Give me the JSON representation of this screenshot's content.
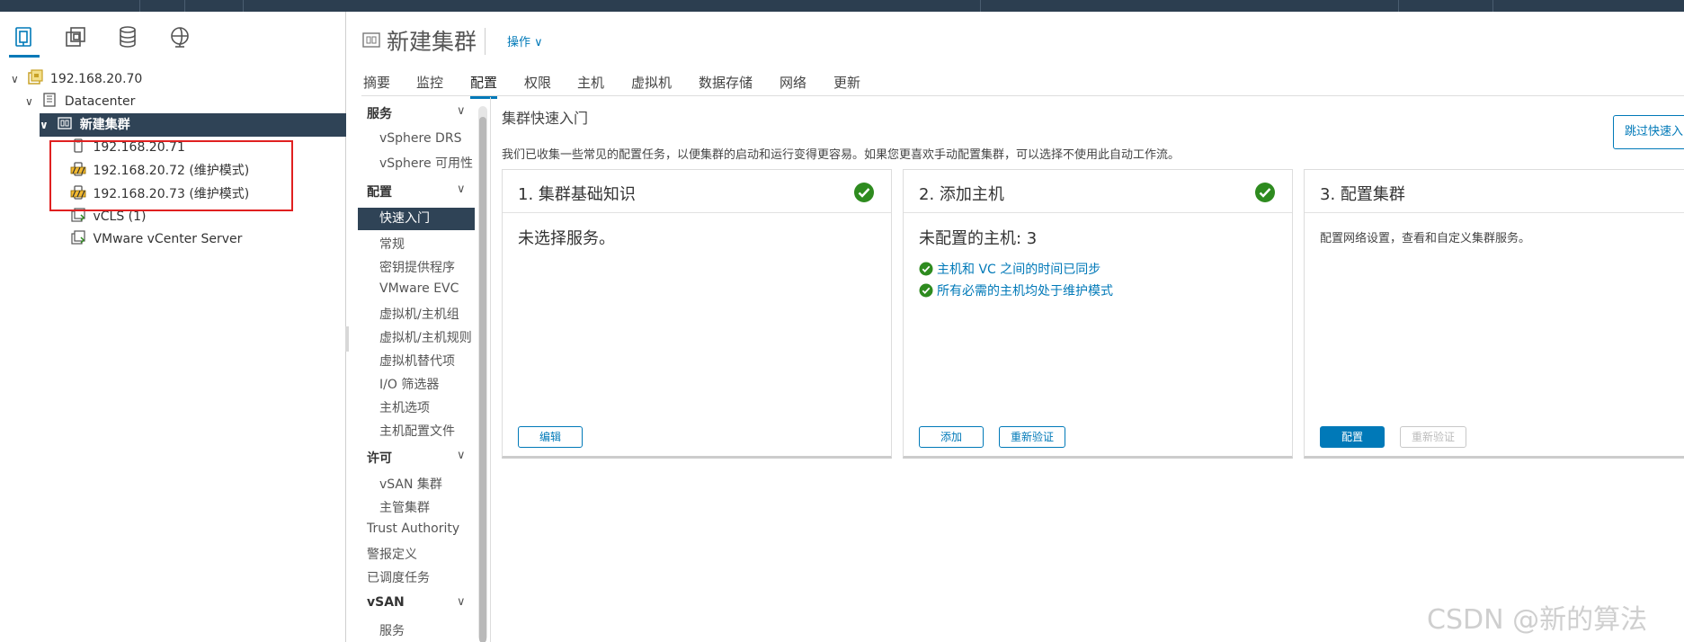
{
  "colors": {
    "accent": "#0079b8",
    "selected_bg": "#2f4356",
    "success": "#2e8b1f",
    "alert_red": "#e02020"
  },
  "nav_icons": [
    "hosts-clusters-icon",
    "vms-templates-icon",
    "storage-icon",
    "network-icon"
  ],
  "tree": {
    "vcenter": "192.168.20.70",
    "datacenter": "Datacenter",
    "cluster": "新建集群",
    "hosts": [
      "192.168.20.71",
      "192.168.20.72 (维护模式)",
      "192.168.20.73 (维护模式)"
    ],
    "vcls": "vCLS (1)",
    "vcenter_vm": "VMware vCenter Server"
  },
  "header": {
    "title": "新建集群",
    "actions": "操作"
  },
  "tabs": [
    "摘要",
    "监控",
    "配置",
    "权限",
    "主机",
    "虚拟机",
    "数据存储",
    "网络",
    "更新"
  ],
  "config_nav": {
    "services_header": "服务",
    "services": [
      "vSphere DRS",
      "vSphere 可用性"
    ],
    "config_header": "配置",
    "config": [
      "快速入门",
      "常规",
      "密钥提供程序",
      "VMware EVC",
      "虚拟机/主机组",
      "虚拟机/主机规则",
      "虚拟机替代项",
      "I/O 筛选器",
      "主机选项",
      "主机配置文件"
    ],
    "license_header": "许可",
    "license": [
      "vSAN 集群",
      "主管集群"
    ],
    "other": [
      "Trust Authority",
      "警报定义",
      "已调度任务"
    ],
    "vsan_header": "vSAN",
    "vsan": [
      "服务"
    ]
  },
  "quickstart": {
    "title": "集群快速入门",
    "skip_button": "跳过快速入门",
    "description": "我们已收集一些常见的配置任务，以便集群的启动和运行变得更容易。如果您更喜欢手动配置集群，可以选择不使用此自动工作流。",
    "card1": {
      "title": "1. 集群基础知识",
      "body": "未选择服务。",
      "edit": "编辑"
    },
    "card2": {
      "title": "2. 添加主机",
      "body": "未配置的主机: 3",
      "check1": "主机和 VC 之间的时间已同步",
      "check2": "所有必需的主机均处于维护模式",
      "add": "添加",
      "revalidate": "重新验证"
    },
    "card3": {
      "title": "3. 配置集群",
      "body": "配置网络设置，查看和自定义集群服务。",
      "configure": "配置",
      "revalidate": "重新验证"
    }
  },
  "watermark": "CSDN @新的算法"
}
